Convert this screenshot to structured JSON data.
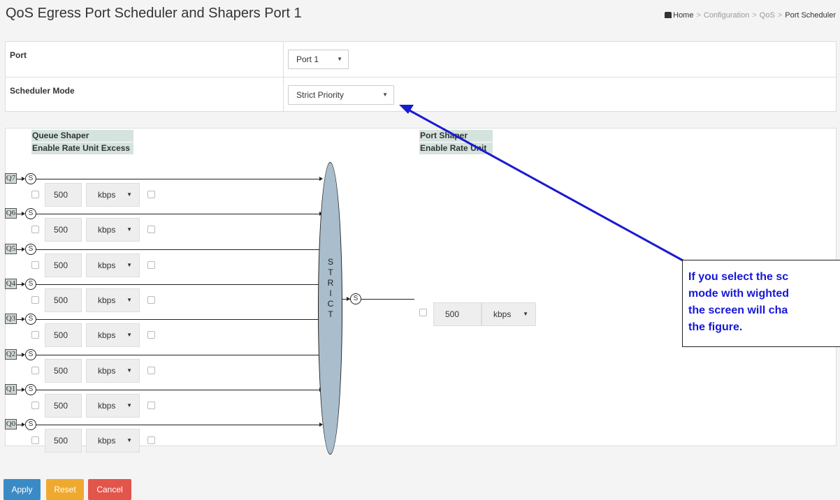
{
  "page": {
    "title": "QoS Egress Port Scheduler and Shapers  Port 1",
    "breadcrumb": {
      "home": "Home",
      "items": [
        "Configuration",
        "QoS",
        "Port Scheduler"
      ]
    }
  },
  "settings": {
    "port_label": "Port",
    "port_value": "Port 1",
    "mode_label": "Scheduler Mode",
    "mode_value": "Strict Priority"
  },
  "queue_shaper": {
    "title": "Queue Shaper",
    "columns": [
      "Enable",
      "Rate",
      "Unit",
      "Excess"
    ]
  },
  "port_shaper": {
    "title": "Port Shaper",
    "columns": [
      "Enable",
      "Rate",
      "Unit"
    ],
    "rate": "500",
    "unit": "kbps"
  },
  "queues": [
    {
      "label": "Q7",
      "rate": "500",
      "unit": "kbps"
    },
    {
      "label": "Q6",
      "rate": "500",
      "unit": "kbps"
    },
    {
      "label": "Q5",
      "rate": "500",
      "unit": "kbps"
    },
    {
      "label": "Q4",
      "rate": "500",
      "unit": "kbps"
    },
    {
      "label": "Q3",
      "rate": "500",
      "unit": "kbps"
    },
    {
      "label": "Q2",
      "rate": "500",
      "unit": "kbps"
    },
    {
      "label": "Q1",
      "rate": "500",
      "unit": "kbps"
    },
    {
      "label": "Q0",
      "rate": "500",
      "unit": "kbps"
    }
  ],
  "shaper_symbol": "S",
  "scheduler_label": "STRICT",
  "annotation": "If you select the sc mode with wighted the screen will cha the figure.",
  "annotation_lines": [
    "If you select the sc",
    "mode with wighted",
    "the screen will cha",
    "the figure."
  ],
  "buttons": {
    "apply": "Apply",
    "reset": "Reset",
    "cancel": "Cancel"
  },
  "colors": {
    "apply": "#3a8bc5",
    "reset": "#f0a92f",
    "cancel": "#e2554b",
    "annotation": "#1717d7",
    "scheduler": "#a9bdcc"
  }
}
